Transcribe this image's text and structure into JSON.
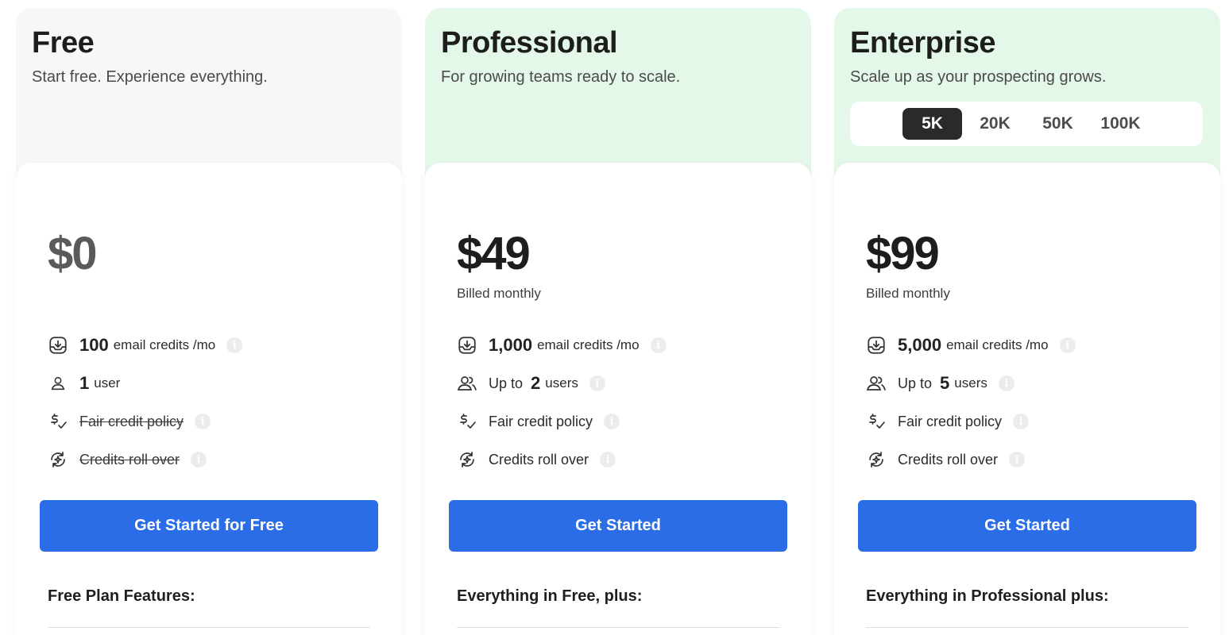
{
  "plans": [
    {
      "name": "Free",
      "subtitle": "Start free. Experience everything.",
      "price": "$0",
      "billed": "",
      "features": [
        {
          "big": "100",
          "prefix": "",
          "text": " email credits /mo",
          "struck": false
        },
        {
          "big": "1",
          "prefix": "",
          "text": " user",
          "struck": false
        },
        {
          "big": "",
          "prefix": "",
          "text": "Fair credit policy",
          "struck": true
        },
        {
          "big": "",
          "prefix": "",
          "text": "Credits roll over",
          "struck": true
        }
      ],
      "cta": "Get Started for Free",
      "includes": "Free Plan Features:"
    },
    {
      "name": "Professional",
      "subtitle": "For growing teams ready to scale.",
      "price": "$49",
      "billed": "Billed monthly",
      "features": [
        {
          "big": "1,000",
          "prefix": "",
          "text": " email credits /mo",
          "struck": false
        },
        {
          "big": "2",
          "prefix": "Up to ",
          "text": " users",
          "struck": false
        },
        {
          "big": "",
          "prefix": "",
          "text": "Fair credit policy",
          "struck": false
        },
        {
          "big": "",
          "prefix": "",
          "text": "Credits roll over",
          "struck": false
        }
      ],
      "cta": "Get Started",
      "includes": "Everything in Free, plus:"
    },
    {
      "name": "Enterprise",
      "subtitle": "Scale up as your prospecting grows.",
      "price": "$99",
      "billed": "Billed monthly",
      "tiers": [
        "5K",
        "20K",
        "50K",
        "100K"
      ],
      "active_tier": "5K",
      "features": [
        {
          "big": "5,000",
          "prefix": "",
          "text": " email credits /mo",
          "struck": false
        },
        {
          "big": "5",
          "prefix": "Up to ",
          "text": " users",
          "struck": false
        },
        {
          "big": "",
          "prefix": "",
          "text": "Fair credit policy",
          "struck": false
        },
        {
          "big": "",
          "prefix": "",
          "text": "Credits roll over",
          "struck": false
        }
      ],
      "cta": "Get Started",
      "includes": "Everything in Professional plus:"
    }
  ],
  "info_glyph": "i",
  "colors": {
    "accent": "#2b6de6",
    "highlight_bg": "#e4f8e9",
    "free_bg": "#f7f7f7"
  }
}
